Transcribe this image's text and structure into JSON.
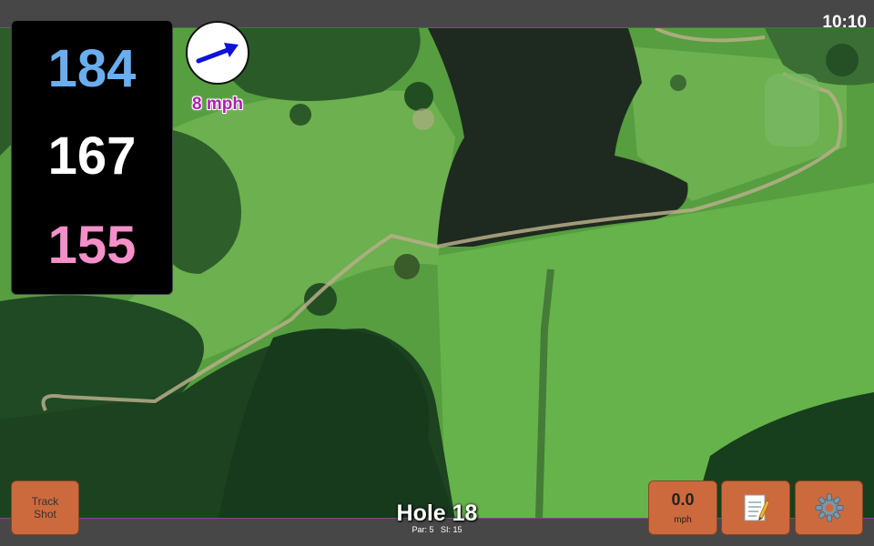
{
  "clock": "10:10",
  "distances": {
    "back": "184",
    "middle": "167",
    "front": "155"
  },
  "wind": {
    "speed_label": "8 mph",
    "icon": "wind-arrow-icon"
  },
  "buttons": {
    "track_shot": {
      "line1": "Track",
      "line2": "Shot"
    },
    "speed": {
      "value": "0.0",
      "unit": "mph"
    },
    "notes_icon": "notepad-icon",
    "settings_icon": "gear-icon"
  },
  "hole": {
    "title": "Hole 18",
    "par_label": "Par: 5",
    "si_label": "SI: 15"
  },
  "colors": {
    "back": "#6aaef0",
    "middle": "#ffffff",
    "front": "#f58fc9",
    "wind_label": "#b01fb0",
    "wind_arrow": "#1111d8",
    "button": "#cc6a3e"
  }
}
